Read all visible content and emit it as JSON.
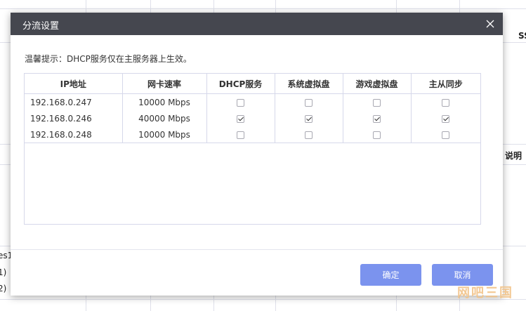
{
  "background": {
    "fragments": [
      "SS",
      "说明",
      "es1",
      "1)",
      "2)"
    ]
  },
  "dialog": {
    "title": "分流设置",
    "hint": "温馨提示：DHCP服务仅在主服务器上生效。",
    "columns": [
      "IP地址",
      "网卡速率",
      "DHCP服务",
      "系统虚拟盘",
      "游戏虚拟盘",
      "主从同步"
    ],
    "rows": [
      {
        "ip": "192.168.0.247",
        "speed": "10000 Mbps",
        "dhcp": false,
        "system_disk": false,
        "game_disk": false,
        "sync": false
      },
      {
        "ip": "192.168.0.246",
        "speed": "40000 Mbps",
        "dhcp": true,
        "system_disk": true,
        "game_disk": true,
        "sync": true
      },
      {
        "ip": "192.168.0.248",
        "speed": "10000 Mbps",
        "dhcp": false,
        "system_disk": false,
        "game_disk": false,
        "sync": false
      }
    ],
    "ok_label": "确定",
    "cancel_label": "取消"
  },
  "watermark": "网吧三国"
}
